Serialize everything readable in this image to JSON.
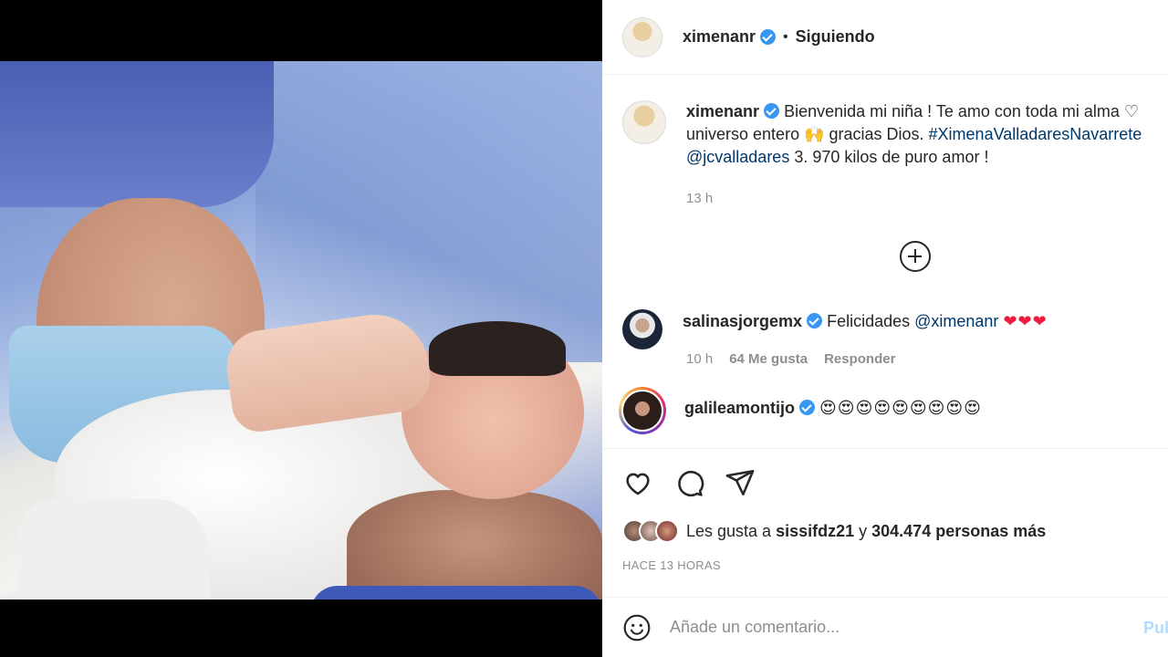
{
  "post": {
    "username": "ximenanr",
    "follow_status": "Siguiendo",
    "separator": "•"
  },
  "caption": {
    "username": "ximenanr",
    "text_1": "Bienvenida mi niña ! Te amo con toda mi alma ♡ universo entero 🙌 gracias Dios. ",
    "hashtag": "#XimenaValladaresNavarrete",
    "mention": "@jcvalladares",
    "text_2": " 3. 970 kilos de puro amor !",
    "time": "13 h"
  },
  "comments": [
    {
      "username": "salinasjorgemx",
      "text": "Felicidades ",
      "mention": "@ximenanr",
      "hearts": "❤❤❤",
      "time": "10 h",
      "likes": "64 Me gusta",
      "reply": "Responder"
    },
    {
      "username": "galileamontijo",
      "emojis": "😍😍😍😍😍😍😍😍😍"
    }
  ],
  "actions": {
    "like_icon": "heart-icon",
    "comment_icon": "comment-icon",
    "share_icon": "share-icon"
  },
  "likes": {
    "prefix": "Les gusta a ",
    "user": "sissifdz21",
    "mid": " y ",
    "count": "304.474 personas más"
  },
  "timestamp": "HACE 13 HORAS",
  "add_comment": {
    "placeholder": "Añade un comentario...",
    "publish": "Publ"
  }
}
